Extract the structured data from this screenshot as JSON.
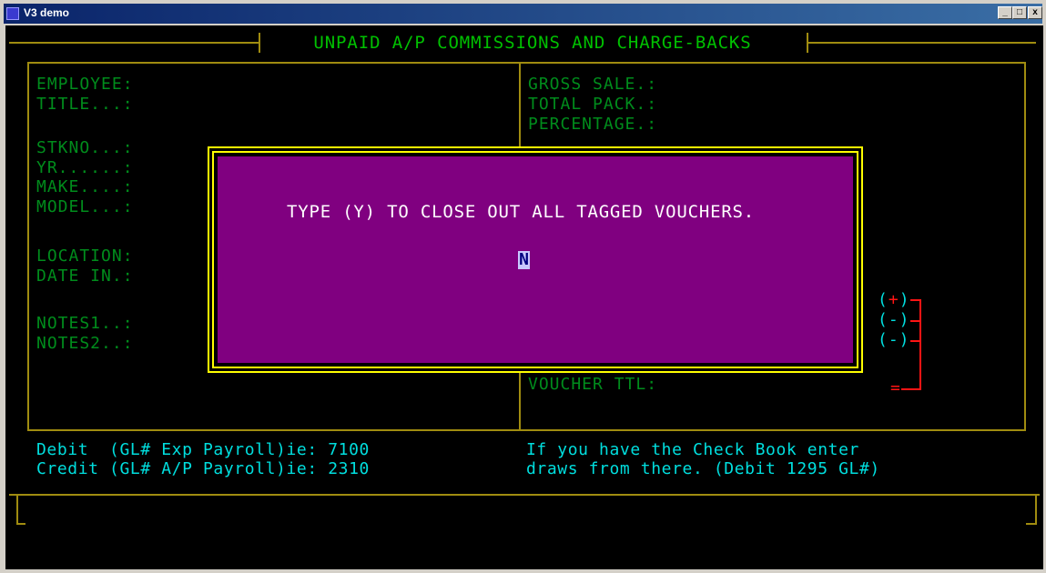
{
  "window": {
    "title": "V3 demo",
    "min_label": "_",
    "max_label": "□",
    "close_label": "x"
  },
  "screen": {
    "title": "UNPAID A/P COMMISSIONS AND CHARGE-BACKS",
    "left_labels": {
      "employee": "EMPLOYEE:",
      "title": "TITLE...:",
      "stkno": "STKNO...:",
      "yr": "YR......:",
      "make": "MAKE....:",
      "model": "MODEL...:",
      "location": "LOCATION:",
      "date_in": "DATE IN.:",
      "notes1": "NOTES1..:",
      "notes2": "NOTES2..:"
    },
    "right_labels": {
      "gross_sale": "GROSS SALE.:",
      "total_pack": "TOTAL PACK.:",
      "percentage": "PERCENTAGE.:",
      "voucher_ttl": "VOUCHER TTL:"
    },
    "signs": {
      "plus": "(+)",
      "minus1": "(-)",
      "minus2": "(-)",
      "equals": "="
    },
    "gl_info": {
      "debit": "Debit  (GL# Exp Payroll)ie: 7100",
      "credit": "Credit (GL# A/P Payroll)ie: 2310",
      "note1": "If you have the Check Book enter",
      "note2": "draws from there. (Debit 1295 GL#)"
    }
  },
  "dialog": {
    "message": "TYPE (Y) TO CLOSE OUT ALL TAGGED VOUCHERS.",
    "input_value": "N"
  }
}
